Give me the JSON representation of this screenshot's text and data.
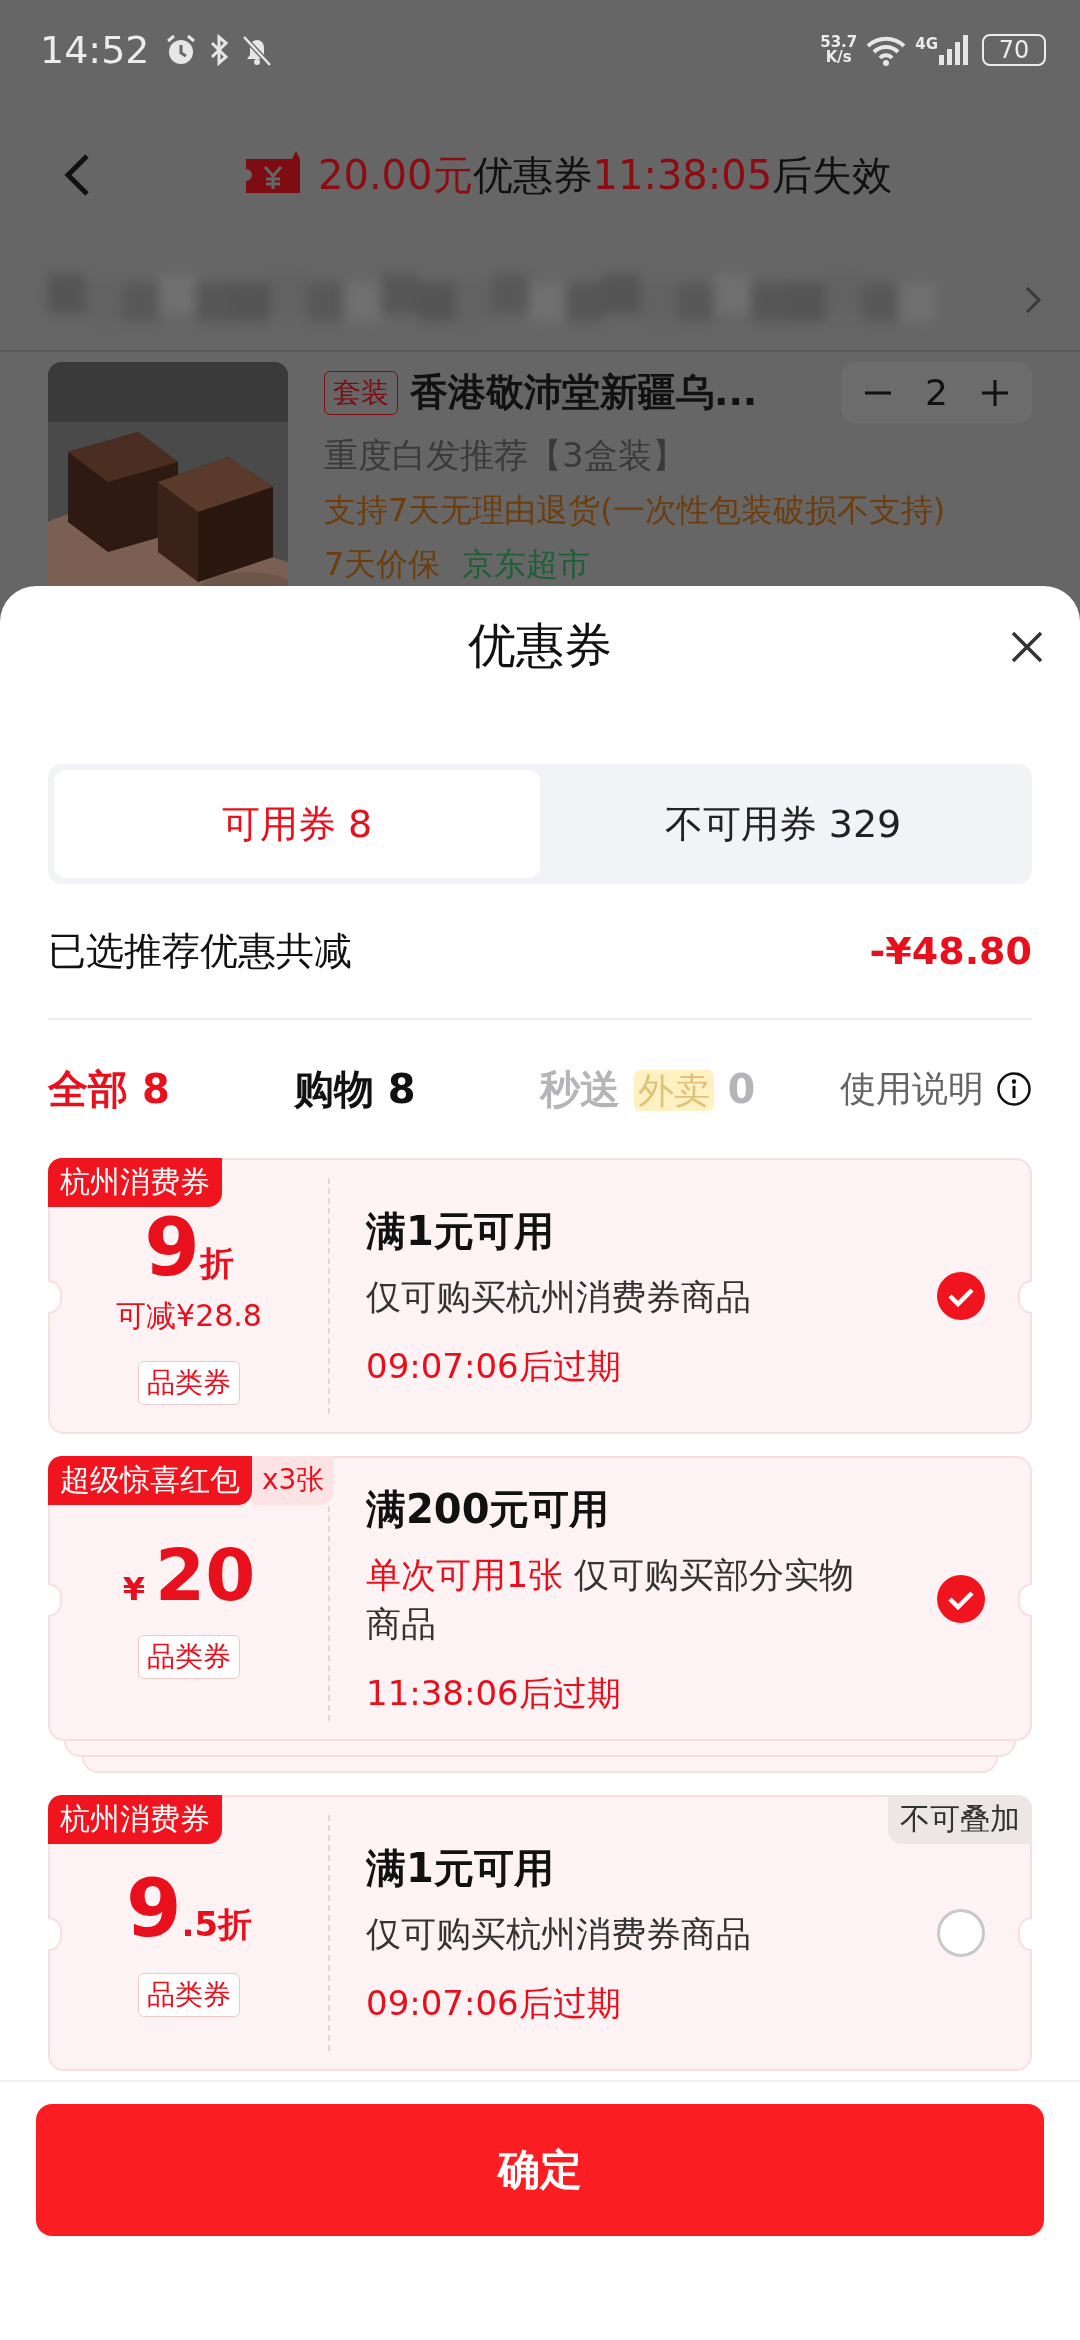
{
  "status_bar": {
    "time": "14:52",
    "net_speed": "53.7",
    "net_unit": "K/s",
    "network": "4G",
    "battery": "70"
  },
  "header": {
    "notice": [
      {
        "text": "20.00元",
        "highlight": true
      },
      {
        "text": "优惠券",
        "highlight": false
      },
      {
        "text": "11:38:05",
        "highlight": true
      },
      {
        "text": "后失效",
        "highlight": false
      }
    ]
  },
  "product": {
    "tag": "套装",
    "title": "香港敬沛堂新疆乌...",
    "quantity": "2",
    "spec": "重度白发推荐【3盒装】",
    "service": "支持7天无理由退货(一次性包装破损不支持)",
    "badges": [
      {
        "text": "7天价保",
        "color": "#6e3d0c"
      },
      {
        "text": "京东超市",
        "color": "#1e6036"
      }
    ]
  },
  "sheet": {
    "title": "优惠券",
    "tabs": [
      {
        "label": "可用券 8",
        "selected": true
      },
      {
        "label": "不可用券 329",
        "selected": false
      }
    ],
    "summary": {
      "label": "已选推荐优惠共减",
      "amount": "-¥48.80"
    },
    "filters": [
      {
        "label": "全部",
        "count": "8",
        "selected": true,
        "disabled": false
      },
      {
        "label": "购物",
        "count": "8",
        "selected": false,
        "disabled": false
      },
      {
        "label": "秒送",
        "tag": "外卖",
        "count": "0",
        "selected": false,
        "disabled": true
      }
    ],
    "help": "使用说明",
    "coupons": [
      {
        "corner_tag": "杭州消费券",
        "value": {
          "kind": "discount",
          "major": "9",
          "minor": "折"
        },
        "saving": "可减¥28.8",
        "type": "品类券",
        "condition": "满1元可用",
        "desc": "仅可购买杭州消费券商品",
        "expiry": "09:07:06后过期",
        "checked": true,
        "stacked": false
      },
      {
        "corner_tag": "超级惊喜红包",
        "count_tag": "x3张",
        "value": {
          "kind": "amount",
          "currency": "¥",
          "major": "20"
        },
        "type": "品类券",
        "condition": "满200元可用",
        "limit": "单次可用1张",
        "desc": "仅可购买部分实物商品",
        "expiry": "11:38:06后过期",
        "checked": true,
        "stacked": true
      },
      {
        "corner_tag": "杭州消费券",
        "stack_label": "不可叠加",
        "value": {
          "kind": "discount",
          "major": "9",
          "minor": ".5折"
        },
        "type": "品类券",
        "condition": "满1元可用",
        "desc": "仅可购买杭州消费券商品",
        "expiry": "09:07:06后过期",
        "checked": false,
        "stacked": false
      }
    ],
    "confirm": "确定"
  }
}
